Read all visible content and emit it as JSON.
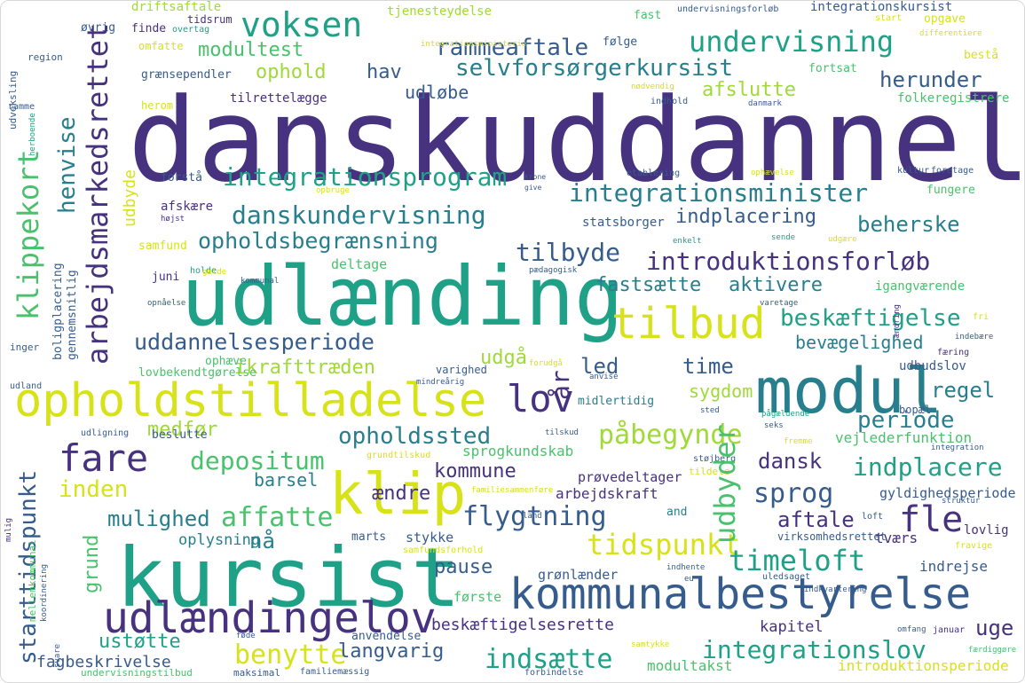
{
  "palette": {
    "background": "#ffffff",
    "dark_purple": "#46327e",
    "blue": "#365c8d",
    "teal_blue": "#277f8e",
    "teal": "#1fa187",
    "green": "#4ac16d",
    "lime": "#a0da39",
    "yellow": "#d7e219"
  },
  "words": {
    "danskuddannelse": "danskuddannelse",
    "kursist": "kursist",
    "udlaending": "udlænding",
    "modul": "modul",
    "opholdstilladelse": "opholdstilladelse",
    "udlaendingelov": "udlændingelov",
    "kommunalbestyrelse": "kommunalbestyrelse",
    "klip": "klip",
    "tilbud": "tilbud",
    "voksen": "voksen",
    "introduktionsforloeb": "introduktionsforløb",
    "integrationsminister": "integrationsminister",
    "arbejdsmarkedsrettet": "arbejdsmarkedsrettet",
    "klippekort": "klippekort",
    "starttidspunkt": "starttidspunkt",
    "undervisning": "undervisning",
    "rammeaftale": "rammeaftale",
    "selvforsoergerkursist": "selvforsørgerkursist",
    "integrationsprogram": "integrationsprogram",
    "danskundervisning": "danskundervisning",
    "opholdsbegraensning": "opholdsbegrænsning",
    "uddannelsesperiode": "uddannelsesperiode",
    "fare": "fare",
    "lov": "lov",
    "fle": "fle",
    "flygtning": "flygtning",
    "tidspunkt": "tidspunkt",
    "timeloft": "timeloft",
    "integrationslov": "integrationslov",
    "benytte": "benytte",
    "indsaette": "indsætte",
    "paabegynde": "påbegynde",
    "opholdssted": "opholdssted",
    "depositum": "depositum",
    "affatte": "affatte",
    "inden": "inden",
    "udbyder": "udbyder",
    "sprog": "sprog",
    "beskaeftigelse": "beskæftigelse",
    "tilbyde": "tilbyde",
    "fastsaette": "fastsætte",
    "aktivere": "aktivere",
    "indplacering": "indplacering",
    "beherske": "beherske",
    "herunder": "herunder",
    "afslutte": "afslutte",
    "modultest": "modultest",
    "ophold": "ophold",
    "hav": "hav",
    "udloebe": "udløbe",
    "henvise": "henvise",
    "udbyde": "udbyde",
    "ar": "år",
    "udgaa": "udgå",
    "led": "led",
    "time": "time",
    "regel": "regel",
    "periode": "periode",
    "sygdom": "sygdom",
    "bevaegelighed": "bevægelighed",
    "dansk": "dansk",
    "indplacere": "indplacere",
    "kommune": "kommune",
    "barsel": "barsel",
    "aendre": "ændre",
    "mulighed": "mulighed",
    "naa": "nå",
    "grund": "grund",
    "pause": "pause",
    "aftale": "aftale",
    "uge": "uge",
    "ustoette": "ustøtte",
    "langvarig": "langvarig",
    "kapitel": "kapitel",
    "fagbeskrivelse": "fagbeskrivelse",
    "beskaeftigelsesrette": "beskæftigelsesrette",
    "ikrafttraeden": "ikrafttræden",
    "medfoer": "medfør",
    "sprogkundskab": "sprogkundskab",
    "arbejdskraft": "arbejdskraft",
    "proevedeltager": "prøvedeltager",
    "stykke": "stykke",
    "marts": "marts",
    "oplysning": "oplysning",
    "groenlaender": "grønlænder",
    "foerste": "første",
    "anvendelse": "anvendelse",
    "modultakst": "modultakst",
    "introduktionsperiode": "introduktionsperiode",
    "gyldighedsperiode": "gyldighedsperiode",
    "indrejse": "indrejse",
    "tvaers": "tværs",
    "lovlig": "lovlig",
    "vejlederfunktion": "vejlederfunktion",
    "udbudslov": "udbudslov",
    "igangvaerende": "igangværende",
    "fungere": "fungere",
    "statsborger": "statsborger",
    "folkeregistrere": "folkeregistrere",
    "tilrettelaegge": "tilrettelægge",
    "graensependler": "grænsependler",
    "fortsat": "fortsat",
    "bestaa": "bestå",
    "opgave": "opgave",
    "integrationskursist": "integrationskursist",
    "driftsaftale": "driftsaftale",
    "tjenesteydelse": "tjenesteydelse",
    "fast": "fast",
    "undervisningsforloeb": "undervisningsforløb",
    "tidsrum": "tidsrum",
    "oevrig": "øvrig",
    "finde": "finde",
    "overtag": "overtag",
    "foelge": "følge",
    "omfatte": "omfatte",
    "integrationsministerie": "integrationsministerie",
    "start": "start",
    "differentiere": "differentiere",
    "region": "region",
    "udveksling": "udveksling",
    "ramme": "ramme",
    "herom": "herom",
    "noedvendig": "nødvendig",
    "indhold": "indhold",
    "danmark": "danmark",
    "herboende": "herboende",
    "forstaa": "forstå",
    "etablering": "etablering",
    "opbruge": "opbruge",
    "ophaevelse": "ophævelse",
    "kultur": "kultur",
    "foretage": "foretage",
    "krone": "krone",
    "give": "give",
    "afskaere": "afskære",
    "hoejst": "højst",
    "enkelt": "enkelt",
    "sende": "sende",
    "udgaere": "udgære",
    "samfund": "samfund",
    "juni": "juni",
    "holde": "holde",
    "gaelde": "gælde",
    "kommunal": "kommunal",
    "paedagogisk": "pædagogisk",
    "deltage": "deltage",
    "varetage": "varetage",
    "fri": "fri",
    "boligplacering": "boligplacering",
    "gennemsnitlig": "gennemsnitlig",
    "opnaaelse": "opnåelse",
    "aendring": "ændring",
    "indebaere": "indebære",
    "inger": "inger",
    "ophaeve": "ophæve",
    "lovbekendtgoerelse": "lovbekendtgørelse",
    "varighed": "varighed",
    "forudgaa": "forudgå",
    "anvise": "anvise",
    "midlertidig": "midlertidig",
    "faering": "færing",
    "mindreaarig": "mindreårig",
    "udland": "udland",
    "sted": "sted",
    "paagaeldende": "pågældende",
    "seks": "seks",
    "bopael": "bopæl",
    "udligning": "udligning",
    "beslutte": "beslutte",
    "tilskud": "tilskud",
    "grundtilskud": "grundtilskud",
    "stoejberg": "støjberg",
    "fremme": "fremme",
    "integration": "integration",
    "tildele": "tildele",
    "familiesammenfoere": "familiesammenføre",
    "and": "and",
    "loft": "loft",
    "struktur": "struktur",
    "land": "land",
    "virksomhedsrettet": "virksomhedsrettet",
    "fravige": "fravige",
    "samfundsforhold": "samfundsforhold",
    "mellemkommunal": "mellemkommunal",
    "koordinering": "koordinering",
    "mulig": "mulig",
    "indhente": "indhente",
    "uledsaget": "uledsaget",
    "indkvartering": "indkvartering",
    "eu": "eu",
    "svare": "svare",
    "foede": "føde",
    "samtykke": "samtykke",
    "omfang": "omfang",
    "januar": "januar",
    "faerdiggoere": "færdiggøre",
    "undervisningstilbud": "undervisningstilbud",
    "maksimal": "maksimal",
    "familiemaessig": "familiemæssig",
    "forbindelse": "forbindelse"
  }
}
